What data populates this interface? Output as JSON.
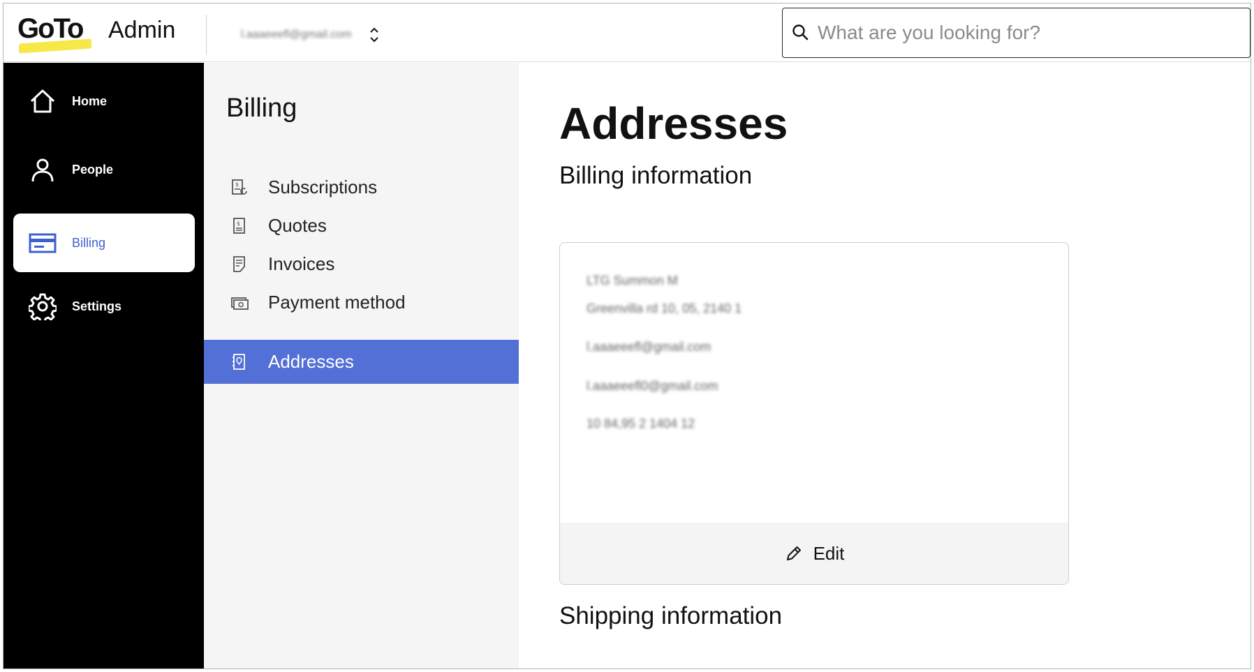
{
  "header": {
    "logo_text": "GoTo",
    "product": "Admin",
    "account_name": "l.aaaeeefl@gmail.com",
    "search_placeholder": "What are you looking for?"
  },
  "leftnav": {
    "items": [
      {
        "label": "Home",
        "icon": "home-icon",
        "active": false
      },
      {
        "label": "People",
        "icon": "person-icon",
        "active": false
      },
      {
        "label": "Billing",
        "icon": "billing-card-icon",
        "active": true
      },
      {
        "label": "Settings",
        "icon": "gear-icon",
        "active": false
      }
    ]
  },
  "subnav": {
    "title": "Billing",
    "items": [
      {
        "label": "Subscriptions",
        "icon": "subscriptions-icon",
        "active": false
      },
      {
        "label": "Quotes",
        "icon": "quotes-icon",
        "active": false
      },
      {
        "label": "Invoices",
        "icon": "invoices-icon",
        "active": false
      },
      {
        "label": "Payment method",
        "icon": "payment-method-icon",
        "active": false
      },
      {
        "label": "Addresses",
        "icon": "address-icon",
        "active": true
      }
    ]
  },
  "main": {
    "title": "Addresses",
    "billing_section_title": "Billing information",
    "billing_card": {
      "lines": [
        "LTG Summon M",
        "Greenvilla rd 10, 05, 2140 1",
        "l.aaaeeefl@gmail.com",
        "l.aaaeeefl0@gmail.com",
        "10 84,95 2 1404 12"
      ],
      "edit_label": "Edit"
    },
    "shipping_section_title": "Shipping information"
  },
  "colors": {
    "accent": "#5270d6",
    "active_nav_text": "#3e5fd0",
    "logo_yellow": "#f6e849",
    "nav_bg": "#000000",
    "subnav_bg": "#f5f5f5"
  }
}
